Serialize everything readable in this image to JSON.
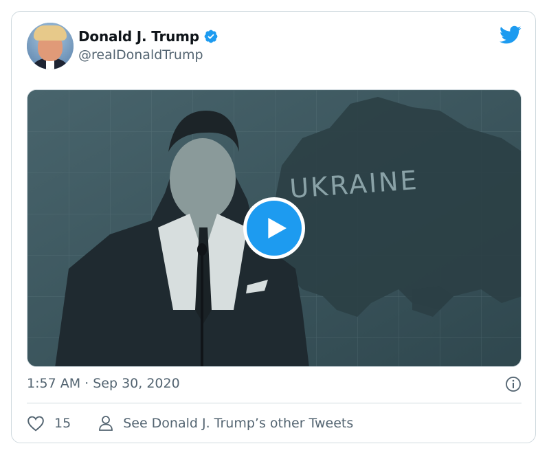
{
  "tweet": {
    "author": {
      "display_name": "Donald J. Trump",
      "handle": "@realDonaldTrump",
      "verified": true
    },
    "media": {
      "type": "video",
      "overlay_text": "UKRAINE"
    },
    "timestamp": "1:57 AM · Sep 30, 2020",
    "likes": "15",
    "profile_link_text": "See Donald J. Trump’s other Tweets"
  },
  "colors": {
    "twitter_blue": "#1d9bf0",
    "text_primary": "#0f1419",
    "text_secondary": "#536471",
    "border": "#cfd9de"
  },
  "icons": {
    "brand": "twitter-bird-icon",
    "verified": "verified-badge-icon",
    "play": "play-icon",
    "info": "info-icon",
    "like": "heart-icon",
    "profile": "person-icon"
  }
}
